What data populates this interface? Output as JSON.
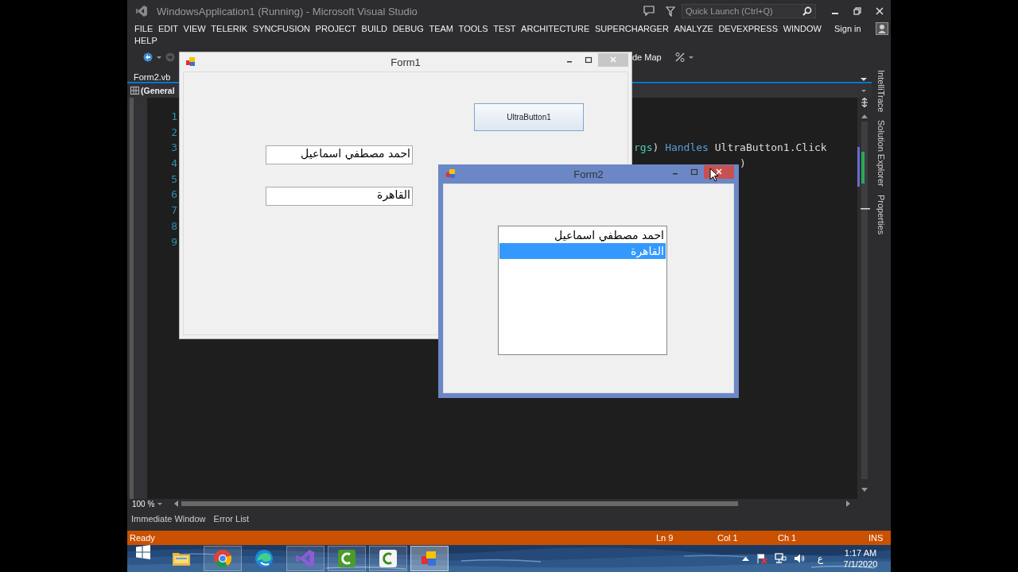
{
  "vs": {
    "title": "WindowsApplication1 (Running) - Microsoft Visual Studio",
    "quick_launch": {
      "placeholder": "Quick Launch (Ctrl+Q)"
    },
    "menu_rows": [
      [
        "FILE",
        "EDIT",
        "VIEW",
        "TELERIK",
        "SYNCFUSION",
        "PROJECT",
        "BUILD",
        "DEBUG",
        "TEAM",
        "TOOLS",
        "TEST",
        "ARCHITECTURE",
        "SUPERCHARGER",
        "ANALYZE",
        "DEVEXPRESS",
        "WINDOW"
      ],
      [
        "HELP"
      ]
    ],
    "sign_in": "Sign in",
    "toolbar": {
      "code_map": "de Map"
    },
    "doc_tabs": [
      {
        "label": "Form2.vb",
        "selected": true
      }
    ],
    "nav": {
      "scope": "(General"
    },
    "lines": [
      {
        "number": "1"
      },
      {
        "number": "2"
      },
      {
        "number": "3",
        "code": [
          {
            "kind": "type",
            "text": "rgs"
          },
          {
            "kind": "plain",
            "text": ") "
          },
          {
            "kind": "keyword",
            "text": "Handles"
          },
          {
            "kind": "plain",
            "text": " UltraButton1.Click"
          }
        ]
      },
      {
        "number": "4",
        "code": [
          {
            "kind": "plain",
            "text": ")"
          }
        ]
      },
      {
        "number": "5"
      },
      {
        "number": "6"
      },
      {
        "number": "7"
      },
      {
        "number": "8"
      },
      {
        "number": "9"
      }
    ],
    "side_tabs": [
      "IntelliTrace",
      "Solution Explorer",
      "Properties"
    ],
    "zoom": "100 %",
    "bottom_tabs": [
      "Immediate Window",
      "Error List"
    ],
    "status": {
      "text": "Ready",
      "ln": "Ln 9",
      "col": "Col 1",
      "ch": "Ch 1",
      "mode": "INS"
    }
  },
  "form1": {
    "title": "Form1",
    "button": "UltraButton1",
    "textboxes": [
      "احمد مصطفي اسماعيل",
      "القاهرة"
    ]
  },
  "form2": {
    "title": "Form2",
    "list": [
      {
        "text": "احمد مصطفي اسماعيل",
        "selected": false
      },
      {
        "text": "القاهرة",
        "selected": true
      }
    ]
  },
  "taskbar": {
    "apps": [
      {
        "kind": "folder",
        "running": false,
        "active": false
      },
      {
        "kind": "browser",
        "running": true,
        "active": false
      },
      {
        "kind": "wave",
        "running": false,
        "active": false
      },
      {
        "kind": "ribbon",
        "running": true,
        "active": false
      },
      {
        "kind": "recorder",
        "running": true,
        "active": false
      },
      {
        "kind": "recorder-light",
        "running": true,
        "active": false
      },
      {
        "kind": "tiles",
        "running": true,
        "active": true
      }
    ],
    "language": "ع",
    "time": "1:17 AM",
    "date": "7/1/2020"
  }
}
